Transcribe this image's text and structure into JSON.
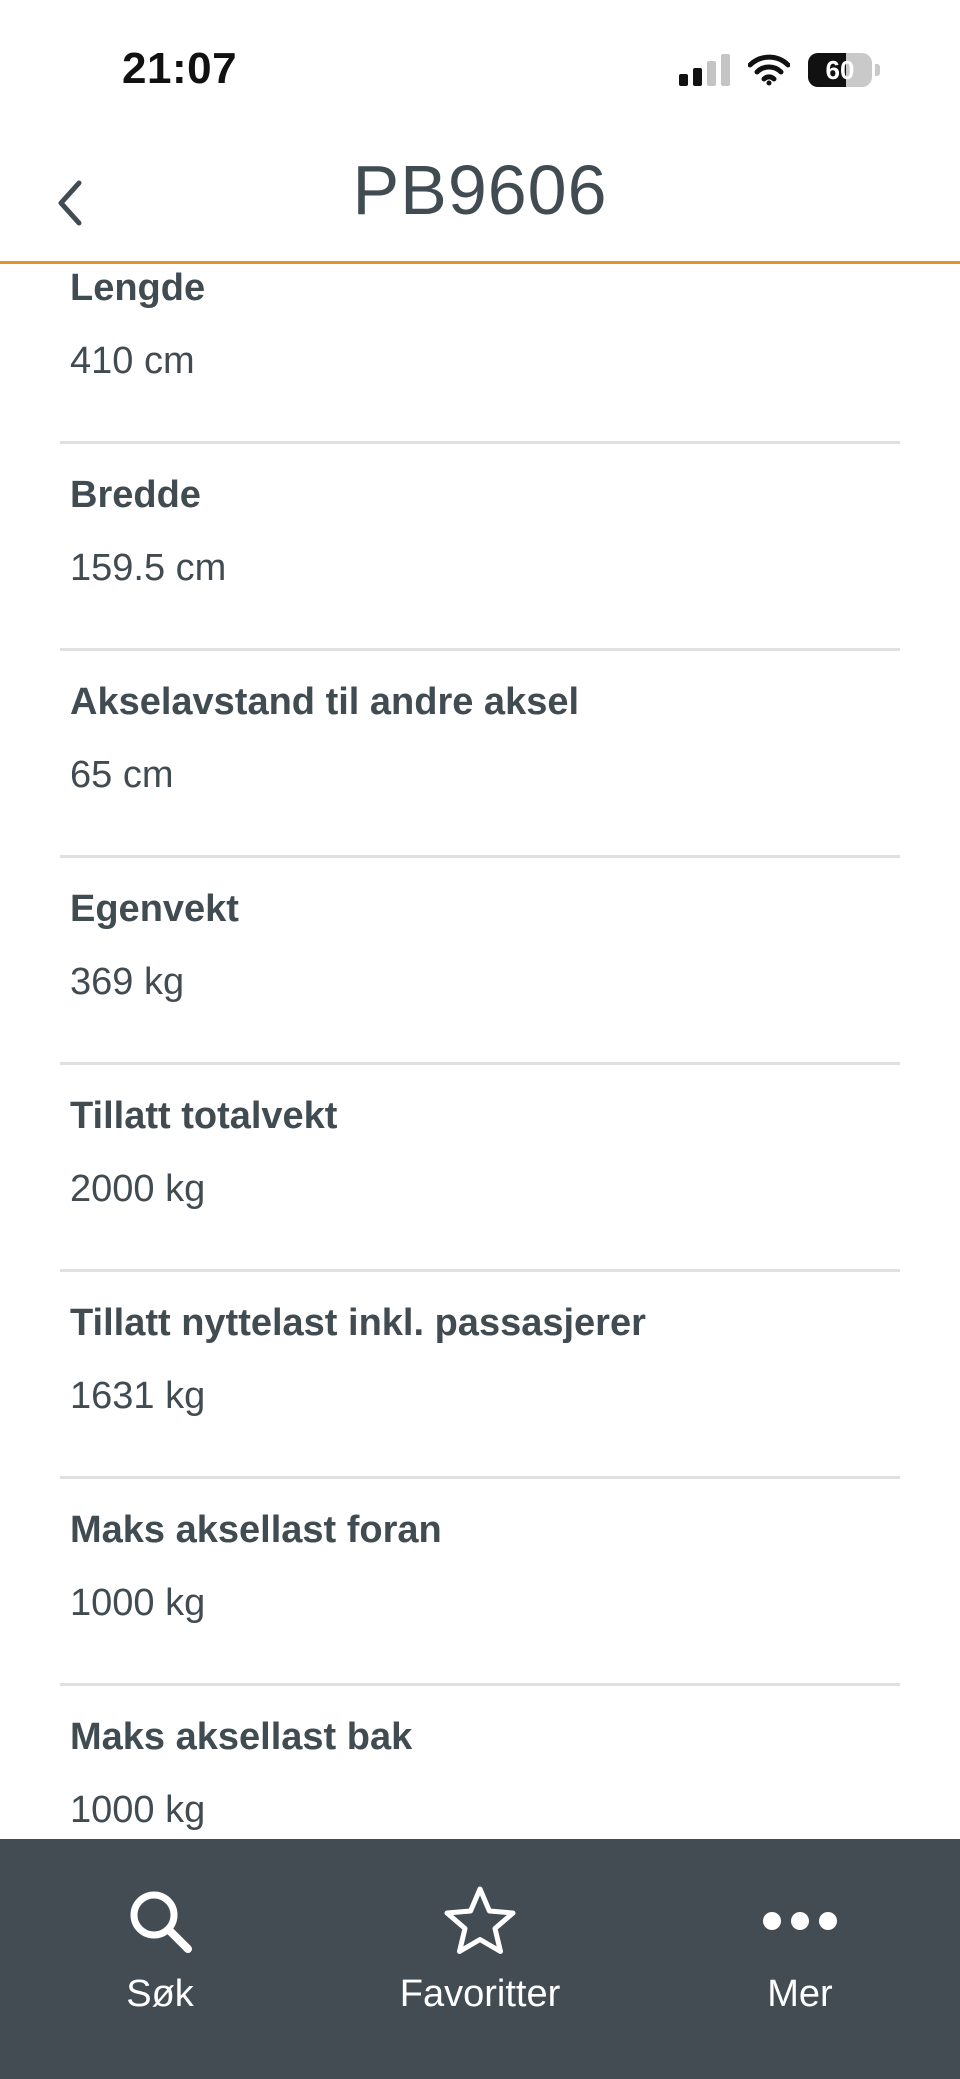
{
  "status_bar": {
    "time": "21:07",
    "battery": "60"
  },
  "header": {
    "title": "PB9606"
  },
  "specs": [
    {
      "label": "Lengde",
      "value": "410 cm"
    },
    {
      "label": "Bredde",
      "value": "159.5 cm"
    },
    {
      "label": "Akselavstand til andre aksel",
      "value": "65 cm"
    },
    {
      "label": "Egenvekt",
      "value": "369 kg"
    },
    {
      "label": "Tillatt totalvekt",
      "value": "2000 kg"
    },
    {
      "label": "Tillatt nyttelast inkl. passasjerer",
      "value": "1631 kg"
    },
    {
      "label": "Maks aksellast foran",
      "value": "1000 kg"
    },
    {
      "label": "Maks aksellast bak",
      "value": "1000 kg"
    }
  ],
  "tabs": [
    {
      "label": "Søk",
      "icon": "search-icon"
    },
    {
      "label": "Favoritter",
      "icon": "star-icon"
    },
    {
      "label": "Mer",
      "icon": "more-icon"
    }
  ],
  "colors": {
    "accent": "#e4922b",
    "text": "#414b52",
    "tab_bar": "#434c53",
    "divider": "#e0e0e0"
  }
}
